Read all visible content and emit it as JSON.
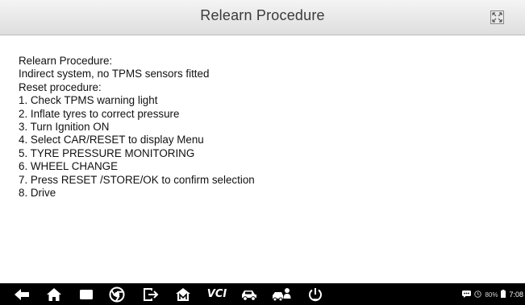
{
  "header": {
    "title": "Relearn Procedure",
    "expand_icon": "expand-icon"
  },
  "content": {
    "lines": [
      "Relearn Procedure:",
      "Indirect system, no TPMS sensors fitted",
      "Reset procedure:",
      "1. Check TPMS warning light",
      "2. Inflate tyres to correct pressure",
      "3. Turn Ignition ON",
      "4. Select CAR/RESET to display Menu",
      "5. TYRE PRESSURE MONITORING",
      "6. WHEEL CHANGE",
      "7. Press RESET /STORE/OK to confirm selection",
      "8. Drive"
    ]
  },
  "navbar": {
    "icons": [
      "back-icon",
      "home-icon",
      "recent-apps-icon",
      "browser-icon",
      "exit-icon",
      "autel-home-icon",
      "vci-icon",
      "car-icon",
      "car-user-icon",
      "power-icon"
    ],
    "vci_label": "VCI",
    "status": {
      "battery_percent": "80%",
      "time": "7:08"
    }
  },
  "colors": {
    "titlebar": "#e6e6e6",
    "navbar": "#000000",
    "text": "#111111"
  }
}
